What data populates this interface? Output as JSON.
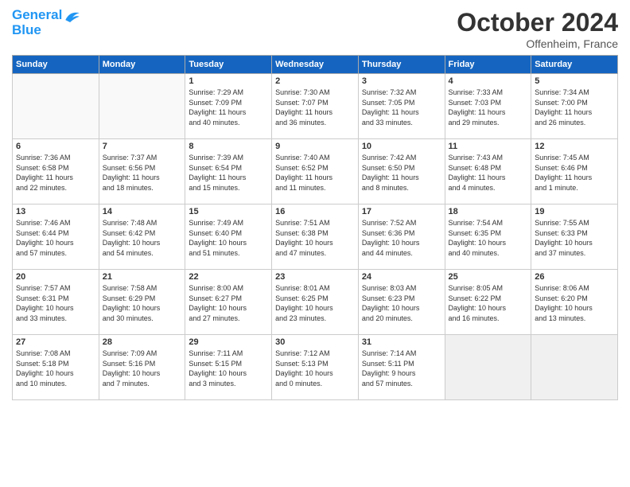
{
  "header": {
    "logo_line1": "General",
    "logo_line2": "Blue",
    "title": "October 2024",
    "location": "Offenheim, France"
  },
  "weekdays": [
    "Sunday",
    "Monday",
    "Tuesday",
    "Wednesday",
    "Thursday",
    "Friday",
    "Saturday"
  ],
  "weeks": [
    [
      {
        "day": "",
        "info": ""
      },
      {
        "day": "",
        "info": ""
      },
      {
        "day": "1",
        "info": "Sunrise: 7:29 AM\nSunset: 7:09 PM\nDaylight: 11 hours\nand 40 minutes."
      },
      {
        "day": "2",
        "info": "Sunrise: 7:30 AM\nSunset: 7:07 PM\nDaylight: 11 hours\nand 36 minutes."
      },
      {
        "day": "3",
        "info": "Sunrise: 7:32 AM\nSunset: 7:05 PM\nDaylight: 11 hours\nand 33 minutes."
      },
      {
        "day": "4",
        "info": "Sunrise: 7:33 AM\nSunset: 7:03 PM\nDaylight: 11 hours\nand 29 minutes."
      },
      {
        "day": "5",
        "info": "Sunrise: 7:34 AM\nSunset: 7:00 PM\nDaylight: 11 hours\nand 26 minutes."
      }
    ],
    [
      {
        "day": "6",
        "info": "Sunrise: 7:36 AM\nSunset: 6:58 PM\nDaylight: 11 hours\nand 22 minutes."
      },
      {
        "day": "7",
        "info": "Sunrise: 7:37 AM\nSunset: 6:56 PM\nDaylight: 11 hours\nand 18 minutes."
      },
      {
        "day": "8",
        "info": "Sunrise: 7:39 AM\nSunset: 6:54 PM\nDaylight: 11 hours\nand 15 minutes."
      },
      {
        "day": "9",
        "info": "Sunrise: 7:40 AM\nSunset: 6:52 PM\nDaylight: 11 hours\nand 11 minutes."
      },
      {
        "day": "10",
        "info": "Sunrise: 7:42 AM\nSunset: 6:50 PM\nDaylight: 11 hours\nand 8 minutes."
      },
      {
        "day": "11",
        "info": "Sunrise: 7:43 AM\nSunset: 6:48 PM\nDaylight: 11 hours\nand 4 minutes."
      },
      {
        "day": "12",
        "info": "Sunrise: 7:45 AM\nSunset: 6:46 PM\nDaylight: 11 hours\nand 1 minute."
      }
    ],
    [
      {
        "day": "13",
        "info": "Sunrise: 7:46 AM\nSunset: 6:44 PM\nDaylight: 10 hours\nand 57 minutes."
      },
      {
        "day": "14",
        "info": "Sunrise: 7:48 AM\nSunset: 6:42 PM\nDaylight: 10 hours\nand 54 minutes."
      },
      {
        "day": "15",
        "info": "Sunrise: 7:49 AM\nSunset: 6:40 PM\nDaylight: 10 hours\nand 51 minutes."
      },
      {
        "day": "16",
        "info": "Sunrise: 7:51 AM\nSunset: 6:38 PM\nDaylight: 10 hours\nand 47 minutes."
      },
      {
        "day": "17",
        "info": "Sunrise: 7:52 AM\nSunset: 6:36 PM\nDaylight: 10 hours\nand 44 minutes."
      },
      {
        "day": "18",
        "info": "Sunrise: 7:54 AM\nSunset: 6:35 PM\nDaylight: 10 hours\nand 40 minutes."
      },
      {
        "day": "19",
        "info": "Sunrise: 7:55 AM\nSunset: 6:33 PM\nDaylight: 10 hours\nand 37 minutes."
      }
    ],
    [
      {
        "day": "20",
        "info": "Sunrise: 7:57 AM\nSunset: 6:31 PM\nDaylight: 10 hours\nand 33 minutes."
      },
      {
        "day": "21",
        "info": "Sunrise: 7:58 AM\nSunset: 6:29 PM\nDaylight: 10 hours\nand 30 minutes."
      },
      {
        "day": "22",
        "info": "Sunrise: 8:00 AM\nSunset: 6:27 PM\nDaylight: 10 hours\nand 27 minutes."
      },
      {
        "day": "23",
        "info": "Sunrise: 8:01 AM\nSunset: 6:25 PM\nDaylight: 10 hours\nand 23 minutes."
      },
      {
        "day": "24",
        "info": "Sunrise: 8:03 AM\nSunset: 6:23 PM\nDaylight: 10 hours\nand 20 minutes."
      },
      {
        "day": "25",
        "info": "Sunrise: 8:05 AM\nSunset: 6:22 PM\nDaylight: 10 hours\nand 16 minutes."
      },
      {
        "day": "26",
        "info": "Sunrise: 8:06 AM\nSunset: 6:20 PM\nDaylight: 10 hours\nand 13 minutes."
      }
    ],
    [
      {
        "day": "27",
        "info": "Sunrise: 7:08 AM\nSunset: 5:18 PM\nDaylight: 10 hours\nand 10 minutes."
      },
      {
        "day": "28",
        "info": "Sunrise: 7:09 AM\nSunset: 5:16 PM\nDaylight: 10 hours\nand 7 minutes."
      },
      {
        "day": "29",
        "info": "Sunrise: 7:11 AM\nSunset: 5:15 PM\nDaylight: 10 hours\nand 3 minutes."
      },
      {
        "day": "30",
        "info": "Sunrise: 7:12 AM\nSunset: 5:13 PM\nDaylight: 10 hours\nand 0 minutes."
      },
      {
        "day": "31",
        "info": "Sunrise: 7:14 AM\nSunset: 5:11 PM\nDaylight: 9 hours\nand 57 minutes."
      },
      {
        "day": "",
        "info": ""
      },
      {
        "day": "",
        "info": ""
      }
    ]
  ]
}
